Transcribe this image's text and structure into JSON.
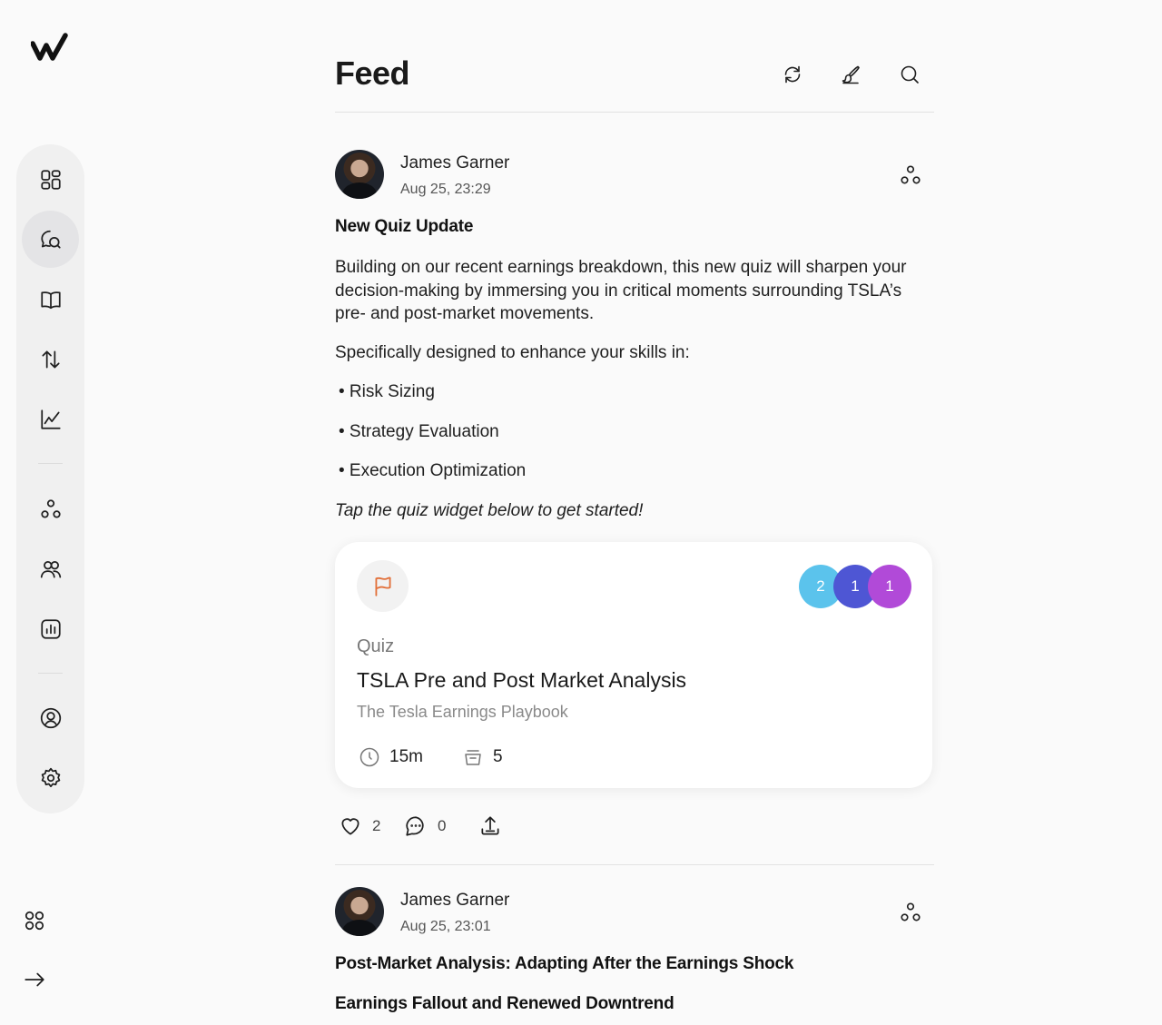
{
  "header": {
    "title": "Feed"
  },
  "sidebar": {
    "items": [
      {
        "name": "dashboard",
        "icon": "grid-icon"
      },
      {
        "name": "feed",
        "icon": "chat-bubbles-icon",
        "active": true
      },
      {
        "name": "library",
        "icon": "book-icon"
      },
      {
        "name": "trades",
        "icon": "arrows-up-down-icon"
      },
      {
        "name": "analytics",
        "icon": "line-chart-icon"
      },
      {
        "name": "community",
        "icon": "circles-group-icon"
      },
      {
        "name": "people",
        "icon": "users-icon"
      },
      {
        "name": "reports",
        "icon": "bar-chart-icon"
      },
      {
        "name": "profile",
        "icon": "user-circle-icon"
      },
      {
        "name": "settings",
        "icon": "gear-icon"
      }
    ],
    "bottom": [
      {
        "name": "apps",
        "icon": "apps-icon"
      },
      {
        "name": "expand",
        "icon": "arrow-right-icon"
      }
    ]
  },
  "posts": [
    {
      "author": "James Garner",
      "date": "Aug 25, 23:29",
      "title": "New Quiz Update",
      "paragraphs": [
        "Building on our recent earnings breakdown, this new quiz will sharpen your decision-making by immersing you in critical moments surrounding TSLA’s pre- and post-market movements.",
        "Specifically designed to enhance your skills in:"
      ],
      "bullets": [
        "• Risk Sizing",
        "• Strategy Evaluation",
        "• Execution Optimization"
      ],
      "cta": "Tap the quiz widget below to get started!",
      "quiz": {
        "type": "Quiz",
        "title": "TSLA Pre and Post Market Analysis",
        "subtitle": "The Tesla Earnings Playbook",
        "duration": "15m",
        "questions": "5",
        "bubbles": [
          {
            "label": "2",
            "color": "#5bc3ec"
          },
          {
            "label": "1",
            "color": "#4e56d4"
          },
          {
            "label": "1",
            "color": "#b14ad8"
          }
        ]
      },
      "likes": "2",
      "comments": "0"
    },
    {
      "author": "James Garner",
      "date": "Aug 25, 23:01",
      "title": "Post-Market Analysis: Adapting After the Earnings Shock",
      "subtitle": "Earnings Fallout and Renewed Downtrend"
    }
  ]
}
